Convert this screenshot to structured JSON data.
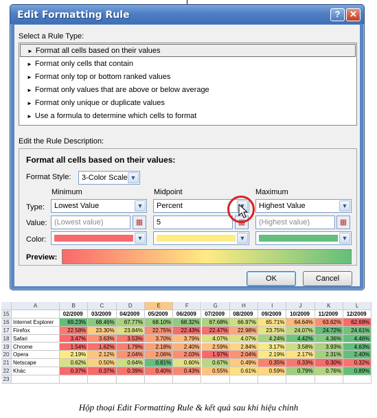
{
  "dialog": {
    "title": "Edit Formatting Rule",
    "help_glyph": "?",
    "close_glyph": "✕",
    "select_rule_type_label": "Select a Rule Type:",
    "rule_types": [
      "Format all cells based on their values",
      "Format only cells that contain",
      "Format only top or bottom ranked values",
      "Format only values that are above or below average",
      "Format only unique or duplicate values",
      "Use a formula to determine which cells to format"
    ],
    "selected_rule_index": 0,
    "edit_description_label": "Edit the Rule Description:",
    "description_heading": "Format all cells based on their values:",
    "format_style_label": "Format Style:",
    "format_style_value": "3-Color Scale",
    "columns": {
      "minimum": {
        "header": "Minimum",
        "type": "Lowest Value",
        "value_placeholder": "(Lowest value)",
        "color": "#f8696b"
      },
      "midpoint": {
        "header": "Midpoint",
        "type": "Percent",
        "value": "5",
        "color": "#ffeb84"
      },
      "maximum": {
        "header": "Maximum",
        "type": "Highest Value",
        "value_placeholder": "(Highest value)",
        "color": "#63be7b"
      }
    },
    "row_labels": {
      "type": "Type:",
      "value": "Value:",
      "color": "Color:"
    },
    "preview_label": "Preview:",
    "ok_label": "OK",
    "cancel_label": "Cancel"
  },
  "sheet": {
    "corner": "",
    "col_letters": [
      "A",
      "B",
      "C",
      "D",
      "E",
      "F",
      "G",
      "H",
      "I",
      "J",
      "K",
      "L"
    ],
    "highlight_col": "E",
    "header_row": {
      "row": "15",
      "cells": [
        "",
        "02/2009",
        "03/2009",
        "04/2009",
        "05/2009",
        "06/2009",
        "07/2009",
        "08/2009",
        "09/2009",
        "10/2009",
        "11/2009",
        "12/2009"
      ]
    },
    "rows": [
      {
        "row": "16",
        "name": "Internet Explorer",
        "values": [
          "69.23%",
          "68.46%",
          "67.77%",
          "68.10%",
          "68.32%",
          "67.68%",
          "66.97%",
          "65.71%",
          "64.64%",
          "63.62%",
          "62.69%"
        ]
      },
      {
        "row": "17",
        "name": "Firefox",
        "values": [
          "22.58%",
          "23.30%",
          "23.84%",
          "22.75%",
          "22.43%",
          "22.47%",
          "22.98%",
          "23.75%",
          "24.07%",
          "24.72%",
          "24.61%"
        ]
      },
      {
        "row": "18",
        "name": "Safari",
        "values": [
          "3.47%",
          "3.63%",
          "3.53%",
          "3.70%",
          "3.79%",
          "4.07%",
          "4.07%",
          "4.24%",
          "4.42%",
          "4.36%",
          "4.46%"
        ]
      },
      {
        "row": "19",
        "name": "Chrome",
        "values": [
          "1.54%",
          "1.62%",
          "1.79%",
          "2.18%",
          "2.40%",
          "2.59%",
          "2.84%",
          "3.17%",
          "3.58%",
          "3.93%",
          "4.63%"
        ]
      },
      {
        "row": "20",
        "name": "Opera",
        "values": [
          "2.19%",
          "2.12%",
          "2.04%",
          "2.06%",
          "2.03%",
          "1.97%",
          "2.04%",
          "2.19%",
          "2.17%",
          "2.31%",
          "2.40%"
        ]
      },
      {
        "row": "21",
        "name": "Netscape",
        "values": [
          "0.62%",
          "0.50%",
          "0.64%",
          "0.81%",
          "0.60%",
          "0.67%",
          "0.49%",
          "0.35%",
          "0.33%",
          "0.30%",
          "0.32%"
        ]
      },
      {
        "row": "22",
        "name": "Khác",
        "values": [
          "0.37%",
          "0.37%",
          "0.39%",
          "0.40%",
          "0.43%",
          "0.55%",
          "0.61%",
          "0.59%",
          "0.79%",
          "0.76%",
          "0.89%"
        ]
      }
    ],
    "trailing_row": "23",
    "scale_colors": {
      "low": "#f8696b",
      "mid": "#ffeb84",
      "high": "#63be7b"
    }
  },
  "caption": "Hộp thoại Edit Formatting Rule & kết quả sau khi hiệu chỉnh"
}
